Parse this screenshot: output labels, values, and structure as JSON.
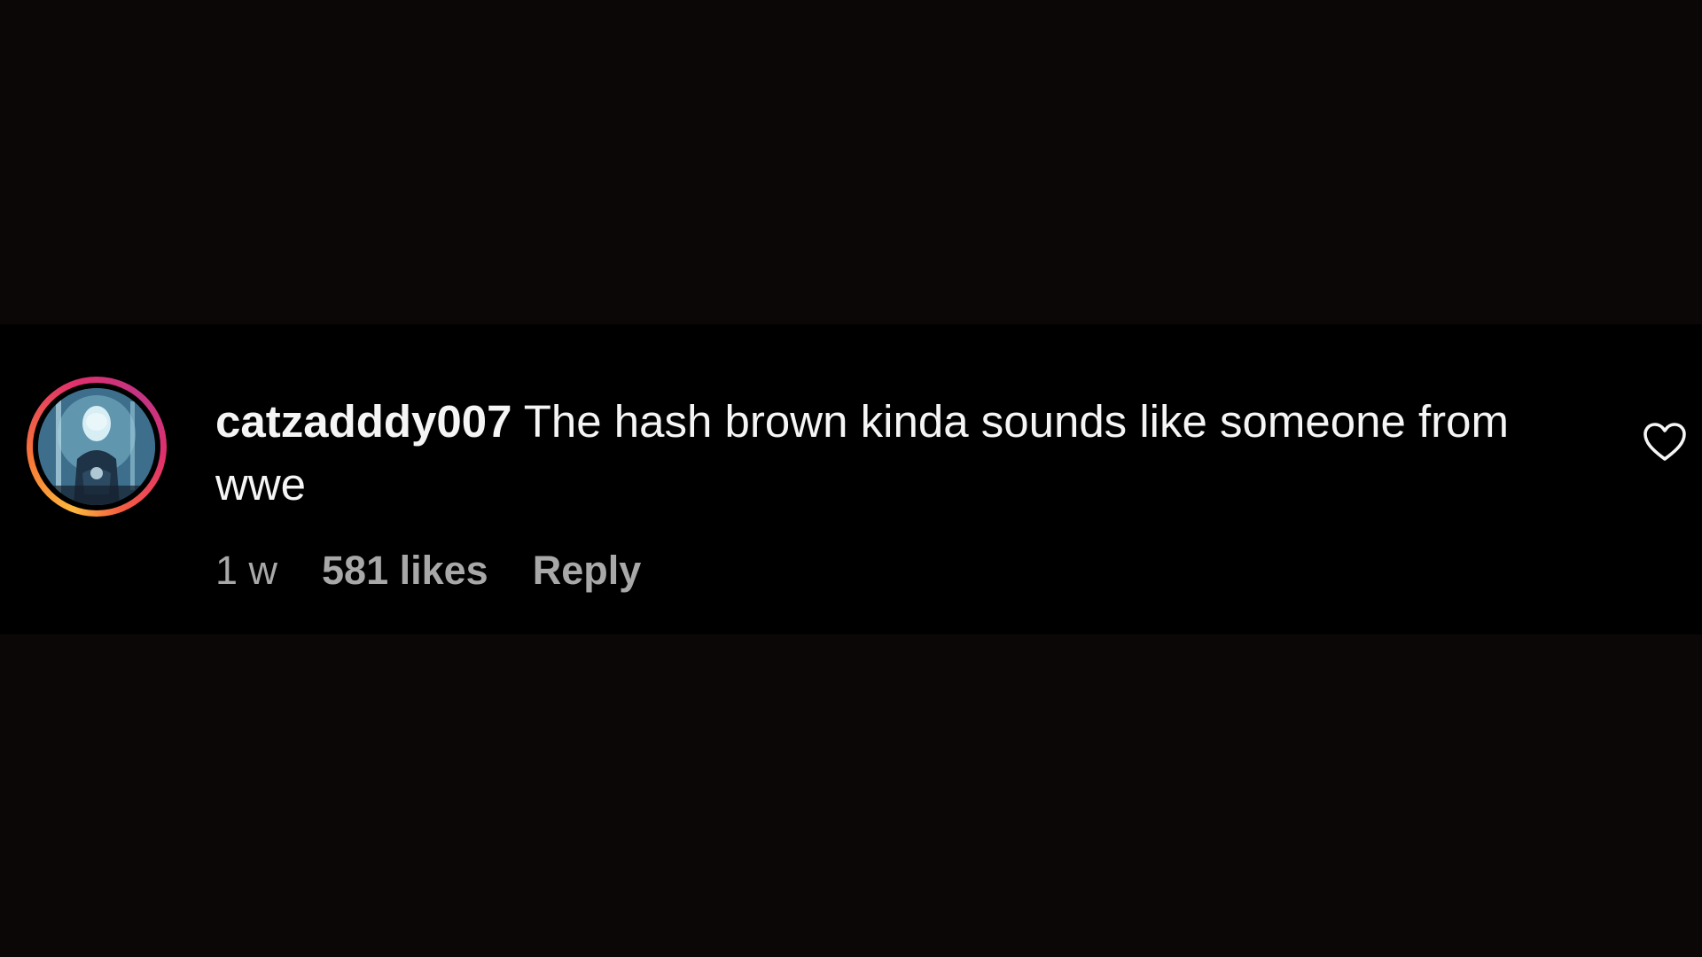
{
  "comment": {
    "username": "catzadddy007",
    "text": "The hash brown kinda sounds like someone from wwe",
    "time": "1 w",
    "likes": "581 likes",
    "reply_label": "Reply",
    "avatar_icon": "user-avatar",
    "like_icon": "heart-outline-icon"
  },
  "colors": {
    "background": "#0b0707",
    "comment_band": "#000000",
    "text_primary": "#f5f5f5",
    "text_secondary": "#a8a8a8"
  }
}
